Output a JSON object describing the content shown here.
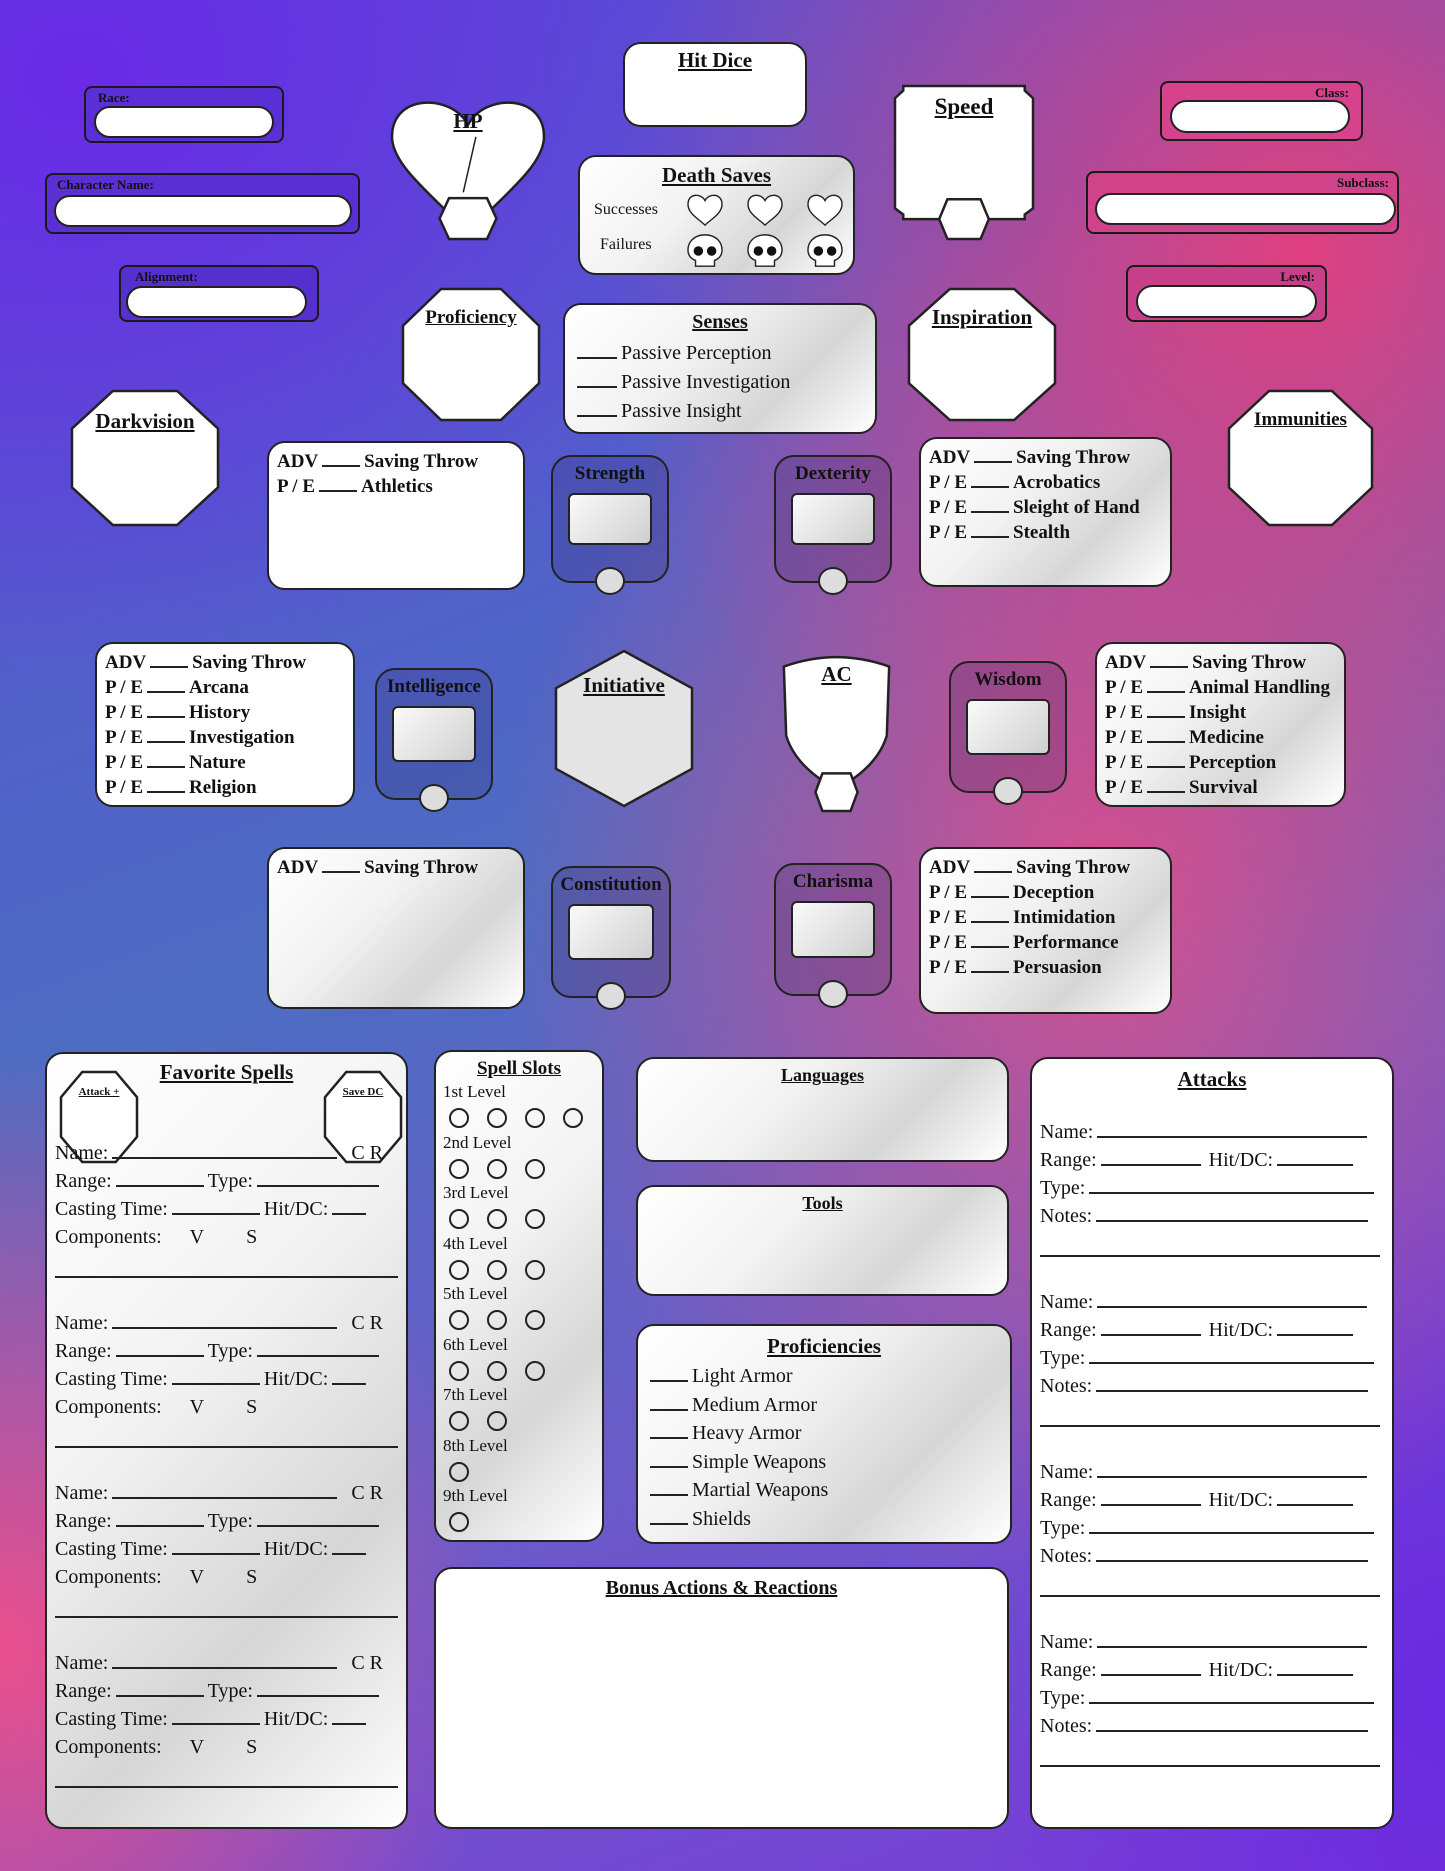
{
  "banners": {
    "race": "Race:",
    "character_name": "Character Name:",
    "alignment": "Alignment:",
    "class": "Class:",
    "subclass": "Subclass:",
    "level": "Level:"
  },
  "colors": {
    "left_banner": "#5b2fd6",
    "right_banner": "#d6438c"
  },
  "hp": {
    "title": "HP"
  },
  "hit_dice": {
    "title": "Hit Dice"
  },
  "death_saves": {
    "title": "Death Saves",
    "successes": "Successes",
    "failures": "Failures",
    "success_icon": "heart-outline",
    "failure_icon": "skull"
  },
  "speed": {
    "title": "Speed"
  },
  "proficiency": {
    "title": "Proficiency"
  },
  "senses": {
    "title": "Senses",
    "items": [
      "Passive Perception",
      "Passive Investigation",
      "Passive Insight"
    ]
  },
  "inspiration": {
    "title": "Inspiration"
  },
  "darkvision": {
    "title": "Darkvision"
  },
  "immunities": {
    "title": "Immunities"
  },
  "initiative": {
    "title": "Initiative"
  },
  "ac": {
    "title": "AC"
  },
  "abilities": {
    "strength": "Strength",
    "dexterity": "Dexterity",
    "intelligence": "Intelligence",
    "wisdom": "Wisdom",
    "constitution": "Constitution",
    "charisma": "Charisma"
  },
  "skills": {
    "str": [
      [
        "ADV",
        "Saving Throw"
      ],
      [
        "P / E",
        "Athletics"
      ]
    ],
    "dex": [
      [
        "ADV",
        "Saving Throw"
      ],
      [
        "P / E",
        "Acrobatics"
      ],
      [
        "P / E",
        "Sleight of Hand"
      ],
      [
        "P / E",
        "Stealth"
      ]
    ],
    "int": [
      [
        "ADV",
        "Saving Throw"
      ],
      [
        "P / E",
        "Arcana"
      ],
      [
        "P / E",
        "History"
      ],
      [
        "P / E",
        "Investigation"
      ],
      [
        "P / E",
        "Nature"
      ],
      [
        "P / E",
        "Religion"
      ]
    ],
    "wis": [
      [
        "ADV",
        "Saving Throw"
      ],
      [
        "P / E",
        "Animal Handling"
      ],
      [
        "P / E",
        "Insight"
      ],
      [
        "P / E",
        "Medicine"
      ],
      [
        "P / E",
        "Perception"
      ],
      [
        "P / E",
        "Survival"
      ]
    ],
    "con": [
      [
        "ADV",
        "Saving Throw"
      ]
    ],
    "cha": [
      [
        "ADV",
        "Saving Throw"
      ],
      [
        "P / E",
        "Deception"
      ],
      [
        "P / E",
        "Intimidation"
      ],
      [
        "P / E",
        "Performance"
      ],
      [
        "P / E",
        "Persuasion"
      ]
    ]
  },
  "favorite_spells": {
    "title": "Favorite Spells",
    "attack": "Attack +",
    "save_dc": "Save DC",
    "name": "Name:",
    "cr": "C R",
    "range": "Range:",
    "type": "Type:",
    "casting_time": "Casting Time:",
    "hit_dc": "Hit/DC:",
    "components": "Components:",
    "v": "V",
    "s": "S",
    "count": 4
  },
  "spell_slots": {
    "title": "Spell Slots",
    "levels": [
      {
        "label": "1st Level",
        "slots": 4
      },
      {
        "label": "2nd Level",
        "slots": 3
      },
      {
        "label": "3rd Level",
        "slots": 3
      },
      {
        "label": "4th Level",
        "slots": 3
      },
      {
        "label": "5th Level",
        "slots": 3
      },
      {
        "label": "6th Level",
        "slots": 3
      },
      {
        "label": "7th Level",
        "slots": 2
      },
      {
        "label": "8th Level",
        "slots": 1
      },
      {
        "label": "9th Level",
        "slots": 1
      }
    ]
  },
  "languages": {
    "title": "Languages"
  },
  "tools": {
    "title": "Tools"
  },
  "proficiencies": {
    "title": "Proficiencies",
    "items": [
      "Light Armor",
      "Medium Armor",
      "Heavy Armor",
      "Simple Weapons",
      "Martial Weapons",
      "Shields"
    ]
  },
  "bonus_actions": {
    "title": "Bonus Actions & Reactions"
  },
  "attacks": {
    "title": "Attacks",
    "name": "Name:",
    "range": "Range:",
    "hit_dc": "Hit/DC:",
    "type": "Type:",
    "notes": "Notes:",
    "count": 4
  }
}
